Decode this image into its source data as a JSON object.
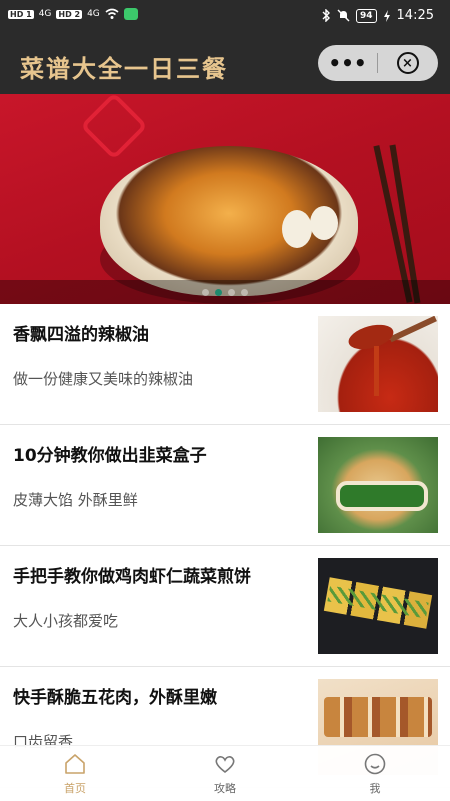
{
  "status_bar": {
    "sim1": "HD 1",
    "sim2": "HD 2",
    "net1": "4G",
    "net2": "4G",
    "battery": "94",
    "time": "14:25"
  },
  "nav": {
    "title": "菜谱大全一日三餐",
    "more_label": "•••",
    "close_label": "×"
  },
  "banner": {
    "slides": 4,
    "active_slide": 2
  },
  "articles": [
    {
      "title": "香飘四溢的辣椒油",
      "subtitle": "做一份健康又美味的辣椒油",
      "thumb": "chili-oil"
    },
    {
      "title": "10分钟教你做出韭菜盒子",
      "subtitle": "皮薄大馅 外酥里鲜",
      "thumb": "chive-dumpling"
    },
    {
      "title": "手把手教你做鸡肉虾仁蔬菜煎饼",
      "subtitle": "大人小孩都爱吃",
      "thumb": "veg-pancake"
    },
    {
      "title": "快手酥脆五花肉，外酥里嫩",
      "subtitle": "口齿留香",
      "thumb": "pork-belly"
    }
  ],
  "tabs": [
    {
      "label": "首页",
      "icon": "home-icon",
      "active": true
    },
    {
      "label": "攻略",
      "icon": "heart-icon",
      "active": false
    },
    {
      "label": "我",
      "icon": "smiley-icon",
      "active": false
    }
  ],
  "colors": {
    "nav_bg": "#2b2b2b",
    "title_gold": "#e7c58e",
    "tab_active": "#c9a36a",
    "carousel_dot_active": "#1e8a6e"
  }
}
